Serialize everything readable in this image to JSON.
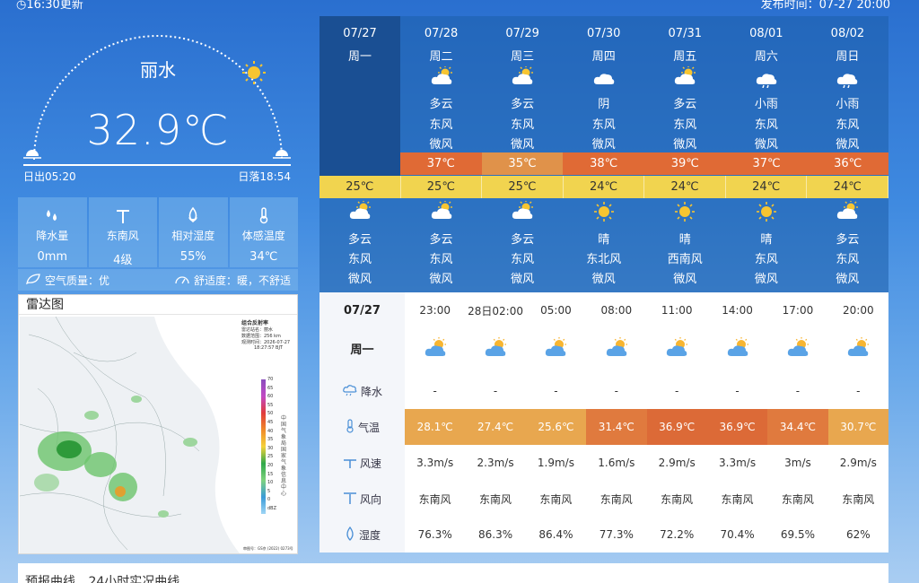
{
  "header": {
    "update_text": "◷16:30更新",
    "publish_text": "发布时间：07-27 20:00"
  },
  "current": {
    "city": "丽水",
    "temperature": "32.9℃",
    "sunrise": "日出05:20",
    "sunset": "日落18:54"
  },
  "stats": [
    {
      "icon": "rain-drops-icon",
      "label": "降水量",
      "value": "0mm"
    },
    {
      "icon": "wind-turbine-icon",
      "label": "东南风",
      "value": "4级"
    },
    {
      "icon": "humidity-icon",
      "label": "相对湿度",
      "value": "55%"
    },
    {
      "icon": "thermometer-icon",
      "label": "体感温度",
      "value": "34℃"
    }
  ],
  "aqi": {
    "air_quality": "空气质量：优",
    "comfort": "舒适度：暖，不舒适"
  },
  "radar": {
    "title": "雷达图",
    "legend_title": "组合反射率",
    "station": "雷达站名：丽水",
    "range": "数据范围：256 km",
    "time_label": "观测时间：2026-07-27",
    "time_value": "18:27:57 BJT",
    "scale": [
      "70",
      "65",
      "60",
      "55",
      "50",
      "45",
      "40",
      "35",
      "30",
      "25",
      "20",
      "15",
      "10",
      "5",
      "0",
      "dBZ"
    ],
    "side_text": "中国气象局国家气象信息中心",
    "footer": "审图号：GS京 (2022) 0273号"
  },
  "forecast": [
    {
      "date": "07/27",
      "weekday": "周一",
      "day_icon": "",
      "day_weather": "",
      "day_wind_dir": "",
      "day_wind_lvl": "",
      "high": "",
      "low": "25℃",
      "night_icon": "partly-cloudy-night",
      "night_weather": "多云",
      "night_wind_dir": "东风",
      "night_wind_lvl": "微风"
    },
    {
      "date": "07/28",
      "weekday": "周二",
      "day_icon": "partly-cloudy",
      "day_weather": "多云",
      "day_wind_dir": "东风",
      "day_wind_lvl": "微风",
      "high": "37℃",
      "low": "25℃",
      "night_icon": "partly-cloudy",
      "night_weather": "多云",
      "night_wind_dir": "东风",
      "night_wind_lvl": "微风"
    },
    {
      "date": "07/29",
      "weekday": "周三",
      "day_icon": "partly-cloudy",
      "day_weather": "多云",
      "day_wind_dir": "东风",
      "day_wind_lvl": "微风",
      "high": "35℃",
      "low": "25℃",
      "night_icon": "partly-cloudy",
      "night_weather": "多云",
      "night_wind_dir": "东风",
      "night_wind_lvl": "微风"
    },
    {
      "date": "07/30",
      "weekday": "周四",
      "day_icon": "overcast",
      "day_weather": "阴",
      "day_wind_dir": "东风",
      "day_wind_lvl": "微风",
      "high": "38℃",
      "low": "24℃",
      "night_icon": "sunny",
      "night_weather": "晴",
      "night_wind_dir": "东北风",
      "night_wind_lvl": "微风"
    },
    {
      "date": "07/31",
      "weekday": "周五",
      "day_icon": "partly-cloudy",
      "day_weather": "多云",
      "day_wind_dir": "东风",
      "day_wind_lvl": "微风",
      "high": "39℃",
      "low": "24℃",
      "night_icon": "sunny",
      "night_weather": "晴",
      "night_wind_dir": "西南风",
      "night_wind_lvl": "微风"
    },
    {
      "date": "08/01",
      "weekday": "周六",
      "day_icon": "light-rain",
      "day_weather": "小雨",
      "day_wind_dir": "东风",
      "day_wind_lvl": "微风",
      "high": "37℃",
      "low": "24℃",
      "night_icon": "sunny",
      "night_weather": "晴",
      "night_wind_dir": "东风",
      "night_wind_lvl": "微风"
    },
    {
      "date": "08/02",
      "weekday": "周日",
      "day_icon": "light-rain",
      "day_weather": "小雨",
      "day_wind_dir": "东风",
      "day_wind_lvl": "微风",
      "high": "36℃",
      "low": "24℃",
      "night_icon": "partly-cloudy",
      "night_weather": "多云",
      "night_wind_dir": "东风",
      "night_wind_lvl": "微风"
    }
  ],
  "high_colors": [
    "#e06a35",
    "#e0924a",
    "#e06a35",
    "#e06a35",
    "#e06a35",
    "#e06a35"
  ],
  "hourly": {
    "date": "07/27",
    "weekday": "周一",
    "times": [
      "23:00",
      "28日02:00",
      "05:00",
      "08:00",
      "11:00",
      "14:00",
      "17:00",
      "20:00"
    ],
    "labels": {
      "rain": "降水",
      "temp": "气温",
      "wind_speed": "风速",
      "wind_dir": "风向",
      "humidity": "湿度"
    },
    "rain": [
      "-",
      "-",
      "-",
      "-",
      "-",
      "-",
      "-",
      "-"
    ],
    "temp": [
      "28.1℃",
      "27.4℃",
      "25.6℃",
      "31.4℃",
      "36.9℃",
      "36.9℃",
      "34.4℃",
      "30.7℃"
    ],
    "temp_colors": [
      "#e8a74f",
      "#e8a74f",
      "#e8a74f",
      "#e07a3e",
      "#dc6a37",
      "#dc6a37",
      "#e07a3e",
      "#e8a74f"
    ],
    "wind_speed": [
      "3.3m/s",
      "2.3m/s",
      "1.9m/s",
      "1.6m/s",
      "2.9m/s",
      "3.3m/s",
      "3m/s",
      "2.9m/s"
    ],
    "wind_dir": [
      "东南风",
      "东南风",
      "东南风",
      "东南风",
      "东南风",
      "东南风",
      "东南风",
      "东南风"
    ],
    "humidity": [
      "76.3%",
      "86.3%",
      "86.4%",
      "77.3%",
      "72.2%",
      "70.4%",
      "69.5%",
      "62%"
    ]
  },
  "bottom_tabs": [
    "预报曲线",
    "24小时实况曲线"
  ]
}
